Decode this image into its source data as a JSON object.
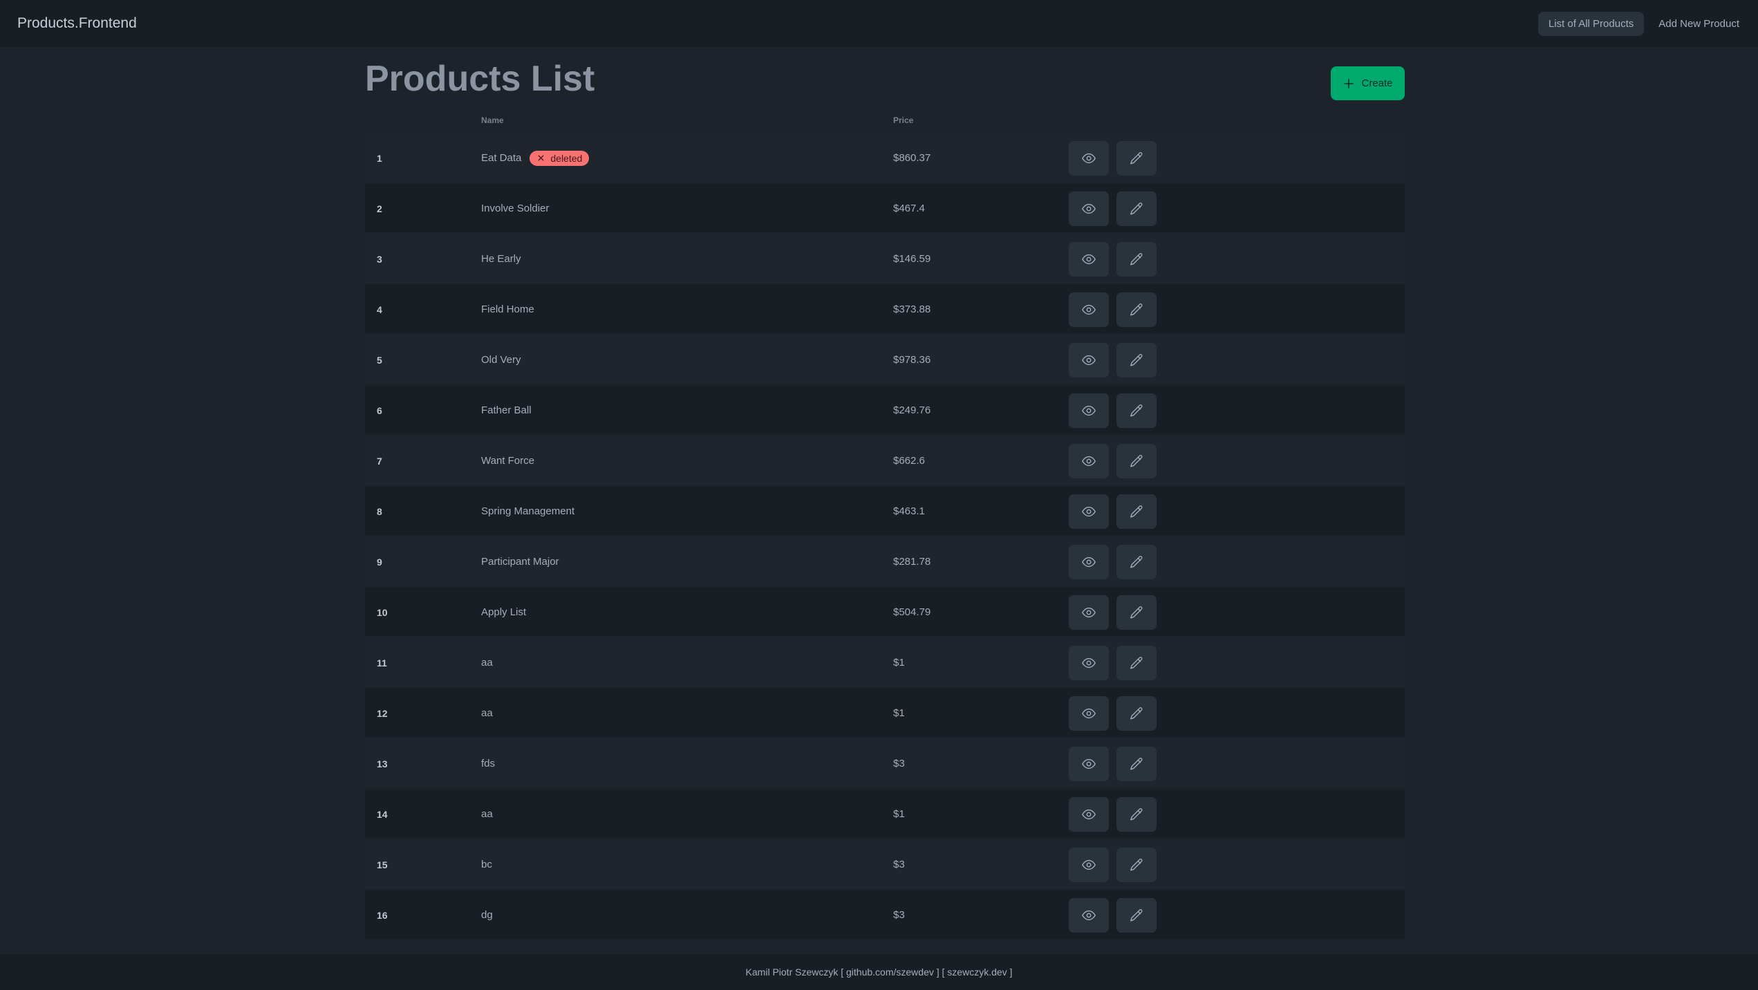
{
  "navbar": {
    "brand": "Products.Frontend",
    "links": [
      {
        "label": "List of All Products",
        "active": true
      },
      {
        "label": "Add New Product",
        "active": false
      }
    ]
  },
  "page": {
    "title": "Products List",
    "create_label": "Create"
  },
  "table": {
    "headers": {
      "id": "",
      "name": "Name",
      "price": "Price"
    },
    "rows": [
      {
        "id": "1",
        "name": "Eat Data",
        "price": "$860.37",
        "badge": "deleted"
      },
      {
        "id": "2",
        "name": "Involve Soldier",
        "price": "$467.4"
      },
      {
        "id": "3",
        "name": "He Early",
        "price": "$146.59"
      },
      {
        "id": "4",
        "name": "Field Home",
        "price": "$373.88"
      },
      {
        "id": "5",
        "name": "Old Very",
        "price": "$978.36"
      },
      {
        "id": "6",
        "name": "Father Ball",
        "price": "$249.76"
      },
      {
        "id": "7",
        "name": "Want Force",
        "price": "$662.6"
      },
      {
        "id": "8",
        "name": "Spring Management",
        "price": "$463.1"
      },
      {
        "id": "9",
        "name": "Participant Major",
        "price": "$281.78"
      },
      {
        "id": "10",
        "name": "Apply List",
        "price": "$504.79"
      },
      {
        "id": "11",
        "name": "aa",
        "price": "$1"
      },
      {
        "id": "12",
        "name": "aa",
        "price": "$1"
      },
      {
        "id": "13",
        "name": "fds",
        "price": "$3"
      },
      {
        "id": "14",
        "name": "aa",
        "price": "$1"
      },
      {
        "id": "15",
        "name": "bc",
        "price": "$3"
      },
      {
        "id": "16",
        "name": "dg",
        "price": "$3"
      }
    ]
  },
  "icons": {
    "view": "eye-icon",
    "edit": "pencil-icon",
    "create": "plus-icon",
    "badge": "x-icon"
  },
  "colors": {
    "background": "#1d232a",
    "navbar": "#191e24",
    "accent": "#00a96e",
    "error": "#f87272"
  },
  "footer": {
    "text": "Kamil Piotr Szewczyk [ github.com/szewdev ] [ szewczyk.dev ]"
  }
}
